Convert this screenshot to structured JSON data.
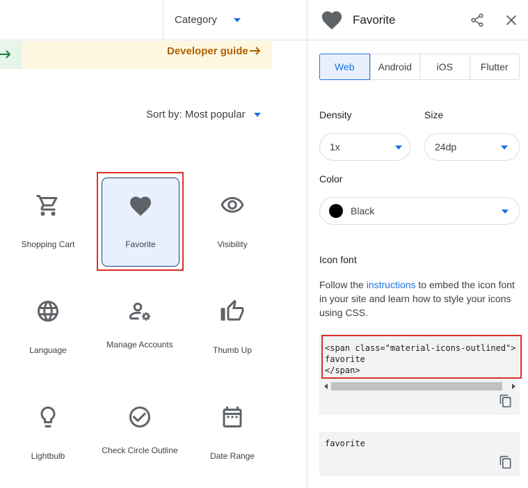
{
  "header": {
    "category_label": "Category"
  },
  "banner": {
    "developer_guide": "Developer guide"
  },
  "sort": {
    "label": "Sort by: Most popular"
  },
  "icons": [
    {
      "label": "Shopping Cart",
      "icon": "shopping-cart-icon"
    },
    {
      "label": "Favorite",
      "icon": "heart-icon",
      "selected": true
    },
    {
      "label": "Visibility",
      "icon": "eye-icon"
    },
    {
      "label": "Language",
      "icon": "globe-icon"
    },
    {
      "label": "Manage Accounts",
      "icon": "manage-accounts-icon"
    },
    {
      "label": "Thumb Up",
      "icon": "thumb-up-icon"
    },
    {
      "label": "Lightbulb",
      "icon": "lightbulb-icon"
    },
    {
      "label": "Check Circle Outline",
      "icon": "check-circle-icon"
    },
    {
      "label": "Date Range",
      "icon": "calendar-icon"
    }
  ],
  "panel": {
    "title": "Favorite",
    "tabs": [
      "Web",
      "Android",
      "iOS",
      "Flutter"
    ],
    "active_tab": "Web",
    "density_label": "Density",
    "density_value": "1x",
    "size_label": "Size",
    "size_value": "24dp",
    "color_label": "Color",
    "color_value": "Black",
    "color_hex": "#000000",
    "section_title": "Icon font",
    "desc_before": "Follow the ",
    "desc_link": "instructions",
    "desc_after": " to embed the icon font in your site and learn how to style your icons using CSS.",
    "code_snippet": "<span class=\"material-icons-outlined\">\nfavorite\n</span>",
    "code_name": "favorite"
  },
  "colors": {
    "accent": "#1a73e8",
    "icon_gray": "#5f6368",
    "highlight_red": "#d93025",
    "selected_bg": "#e8f0fe",
    "banner_yellow": "#fef7e0",
    "banner_green": "#e6f4ea",
    "guide_text": "#b06000"
  }
}
